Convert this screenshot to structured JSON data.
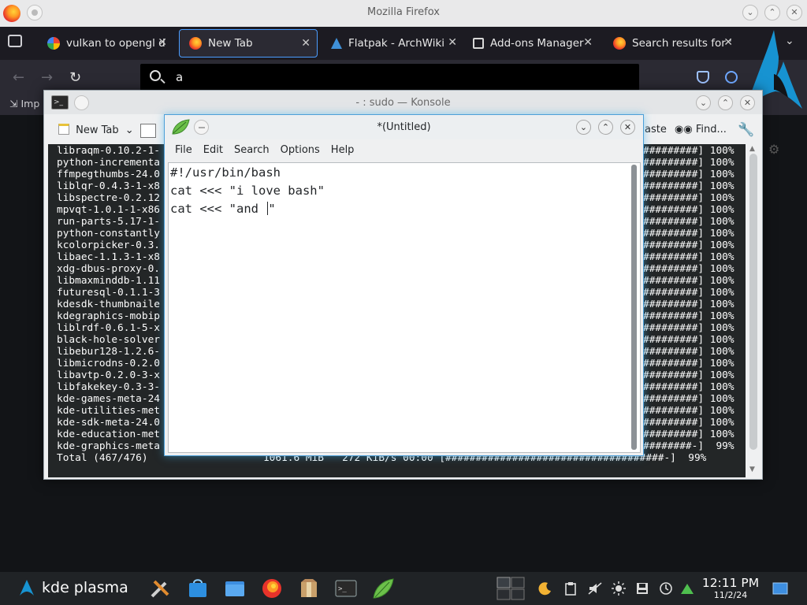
{
  "firefox": {
    "window_title": "Mozilla Firefox",
    "tabs": [
      {
        "label": "vulkan to opengl d",
        "active": false
      },
      {
        "label": "New Tab",
        "active": true
      },
      {
        "label": "Flatpak - ArchWiki",
        "active": false
      },
      {
        "label": "Add-ons Manager",
        "active": false
      },
      {
        "label": "Search results for '",
        "active": false
      }
    ],
    "url_value": "a",
    "bookmark_partial": "Imp"
  },
  "konsole": {
    "title": "- : sudo — Konsole",
    "toolbar": {
      "new_tab": "New Tab",
      "paste": "aste",
      "find": "Find..."
    },
    "lines": [
      {
        "left": "libraqm-0.10.2-1-",
        "right": "#########] 100%"
      },
      {
        "left": "python-incrementa",
        "right": "#########] 100%"
      },
      {
        "left": "ffmpegthumbs-24.0",
        "right": "#########] 100%"
      },
      {
        "left": "liblqr-0.4.3-1-x8",
        "right": "#########] 100%"
      },
      {
        "left": "libspectre-0.2.12",
        "right": "#########] 100%"
      },
      {
        "left": "mpvqt-1.0.1-1-x86",
        "right": "#########] 100%"
      },
      {
        "left": "run-parts-5.17-1-",
        "right": "#########] 100%"
      },
      {
        "left": "python-constantly",
        "right": "#########] 100%"
      },
      {
        "left": "kcolorpicker-0.3.",
        "right": "#########] 100%"
      },
      {
        "left": "libaec-1.1.3-1-x8",
        "right": "#########] 100%"
      },
      {
        "left": "xdg-dbus-proxy-0.",
        "right": "#########] 100%"
      },
      {
        "left": "libmaxminddb-1.11",
        "right": "#########] 100%"
      },
      {
        "left": "futuresql-0.1.1-3",
        "right": "#########] 100%"
      },
      {
        "left": "kdesdk-thumbnaile",
        "right": "#########] 100%"
      },
      {
        "left": "kdegraphics-mobip",
        "right": "#########] 100%"
      },
      {
        "left": "liblrdf-0.6.1-5-x",
        "right": "#########] 100%"
      },
      {
        "left": "black-hole-solver",
        "right": "#########] 100%"
      },
      {
        "left": "libebur128-1.2.6-",
        "right": "#########] 100%"
      },
      {
        "left": "libmicrodns-0.2.0",
        "right": "#########] 100%"
      },
      {
        "left": "libavtp-0.2.0-3-x",
        "right": "#########] 100%"
      },
      {
        "left": "libfakekey-0.3-3-",
        "right": "#########] 100%"
      },
      {
        "left": "kde-games-meta-24",
        "right": "#########] 100%"
      },
      {
        "left": "kde-utilities-met",
        "right": "#########] 100%"
      },
      {
        "left": "kde-sdk-meta-24.0",
        "right": "#########] 100%"
      },
      {
        "left": "kde-education-met",
        "right": "#########] 100%"
      },
      {
        "left": "kde-graphics-meta",
        "right": "########-]  99%"
      }
    ],
    "total_line": "Total (467/476)                   1061.6 MiB   272 KiB/s 00:00 [####################################-]  99%"
  },
  "editor": {
    "title": "*(Untitled)",
    "menu": [
      "File",
      "Edit",
      "Search",
      "Options",
      "Help"
    ],
    "lines": [
      "#!/usr/bin/bash",
      "cat <<< \"i love bash\"",
      "cat <<< \"and "
    ]
  },
  "taskbar": {
    "launcher_label": "kde plasma",
    "time": "12:11 PM",
    "date": "11/2/24"
  },
  "colors": {
    "accent": "#3daee9",
    "tab_border": "#4b9dff",
    "terminal_bg": "#232627",
    "panel_bg": "#202326"
  }
}
